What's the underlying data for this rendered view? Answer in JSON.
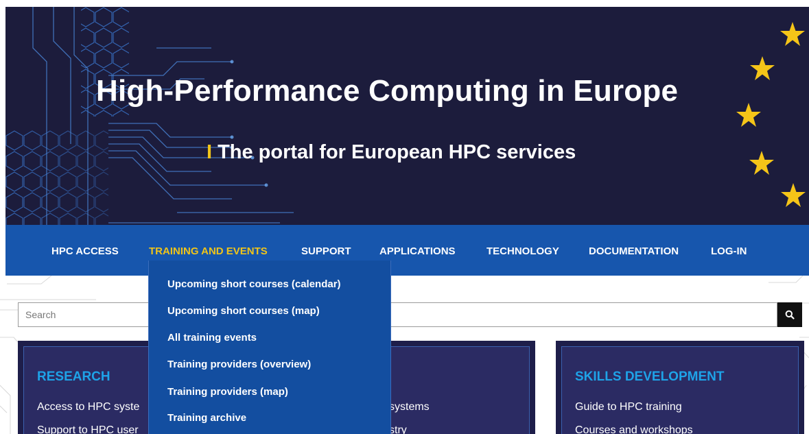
{
  "banner": {
    "title": "High-Performance Computing in Europe",
    "subtitle": "The portal for European HPC services",
    "subtitle_bar": "I",
    "star_icon": "star-icon",
    "accent_color": "#f0c419"
  },
  "nav": {
    "items": [
      {
        "label": "HPC ACCESS"
      },
      {
        "label": "TRAINING AND EVENTS"
      },
      {
        "label": "SUPPORT"
      },
      {
        "label": "APPLICATIONS"
      },
      {
        "label": "TECHNOLOGY"
      },
      {
        "label": "DOCUMENTATION"
      },
      {
        "label": "LOG-IN"
      }
    ],
    "active": "TRAINING AND EVENTS"
  },
  "dropdown": {
    "items": [
      {
        "label": "Upcoming short courses (calendar)"
      },
      {
        "label": "Upcoming short courses (map)"
      },
      {
        "label": "All training events"
      },
      {
        "label": "Training providers (overview)"
      },
      {
        "label": "Training providers (map)"
      },
      {
        "label": "Training archive"
      }
    ]
  },
  "search": {
    "placeholder": "Search",
    "button_icon": "search-icon"
  },
  "cards": {
    "research": {
      "title": "RESEARCH",
      "links": [
        "Access to HPC syste",
        "Support to HPC user"
      ]
    },
    "middle": {
      "links": [
        "systems",
        "stry"
      ]
    },
    "skills": {
      "title": "SKILLS DEVELOPMENT",
      "links": [
        "Guide to HPC training",
        "Courses and workshops"
      ]
    }
  }
}
